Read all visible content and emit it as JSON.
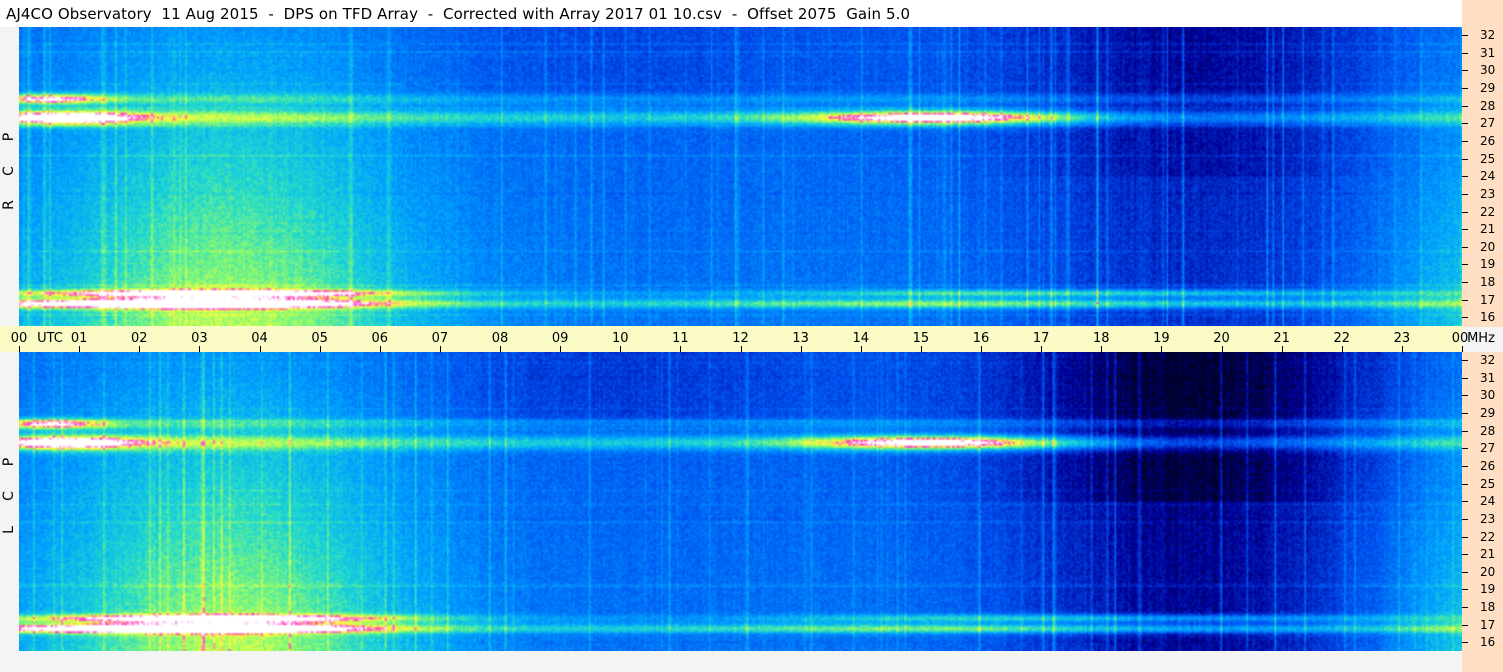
{
  "title": "AJ4CO Observatory  11 Aug 2015  -  DPS on TFD Array  -  Corrected with Array 2017 01 10.csv  -  Offset 2075  Gain 5.0",
  "panels": [
    {
      "id": "rcp",
      "polarization": [
        "R",
        "C",
        "P"
      ]
    },
    {
      "id": "lcp",
      "polarization": [
        "L",
        "C",
        "P"
      ]
    }
  ],
  "time_axis": {
    "labels": [
      "00",
      "01",
      "02",
      "03",
      "04",
      "05",
      "06",
      "07",
      "08",
      "09",
      "10",
      "11",
      "12",
      "13",
      "14",
      "15",
      "16",
      "17",
      "18",
      "19",
      "20",
      "21",
      "22",
      "23",
      "00"
    ],
    "unit": "UTC",
    "freq_unit": "MHz"
  },
  "freq_axis": {
    "labels": [
      "32",
      "31",
      "30",
      "29",
      "28",
      "27",
      "26",
      "25",
      "24",
      "23",
      "22",
      "21",
      "20",
      "19",
      "18",
      "17",
      "16"
    ]
  },
  "chart_data": {
    "type": "heatmap",
    "title": "AJ4CO Observatory  11 Aug 2015  -  DPS on TFD Array  -  Corrected with Array 2017 01 10.csv  -  Offset 2075  Gain 5.0",
    "xlabel": "UTC",
    "ylabel": "MHz",
    "xlim": [
      0,
      24
    ],
    "ylim": [
      16,
      32
    ],
    "series": [
      {
        "name": "R C P"
      },
      {
        "name": "L C P"
      }
    ],
    "colormap": [
      "#000033",
      "#0000aa",
      "#0055ff",
      "#00aaff",
      "#22ddcc",
      "#99ff66",
      "#ffff33",
      "#ff33cc",
      "#ffffff"
    ],
    "bright_bands_mhz": [
      17.2,
      17.8,
      27.2,
      28.2
    ]
  }
}
